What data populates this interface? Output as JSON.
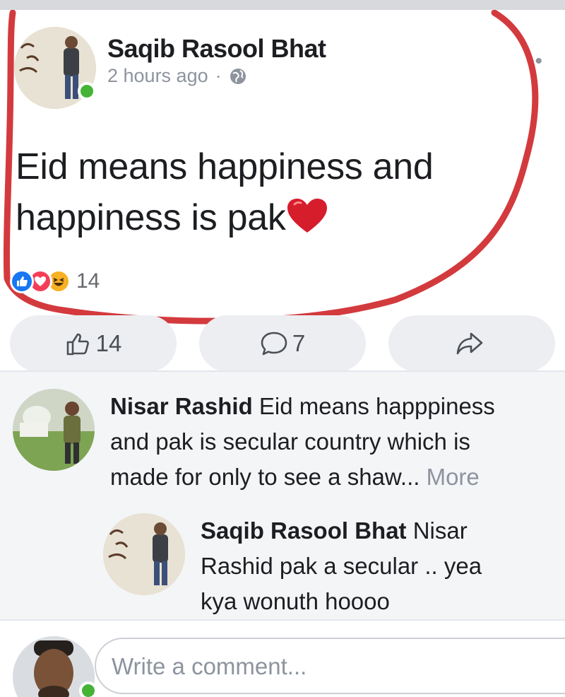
{
  "post": {
    "author": "Saqib Rasool Bhat",
    "time": "2 hours ago",
    "separator": "·",
    "privacy_icon": "globe-icon",
    "menu_icon": "more-icon",
    "text_line1": "Eid means happiness and",
    "text_line2": "happiness is pak",
    "emoji": "red-heart",
    "reactions": [
      "like",
      "love",
      "haha"
    ],
    "reaction_count": "14"
  },
  "actions": {
    "like_count": "14",
    "comment_count": "7",
    "share_icon": "share-icon"
  },
  "comments": [
    {
      "author": "Nisar Rashid",
      "line1": "Eid means happpiness",
      "line2": "and pak is secular country which is",
      "line3": "made for only to see a shaw...",
      "more": "More"
    },
    {
      "author": "Saqib Rasool Bhat",
      "line1": "Nisar",
      "line2": "Rashid pak a secular .. yea",
      "line3": "kya wonuth hoooo"
    }
  ],
  "composer": {
    "placeholder": "Write a comment..."
  },
  "colors": {
    "annotation": "#d33a3e",
    "online": "#44b336",
    "like": "#1877f2",
    "love": "#f33e58",
    "haha": "#f7b125",
    "muted": "#8d949e"
  }
}
